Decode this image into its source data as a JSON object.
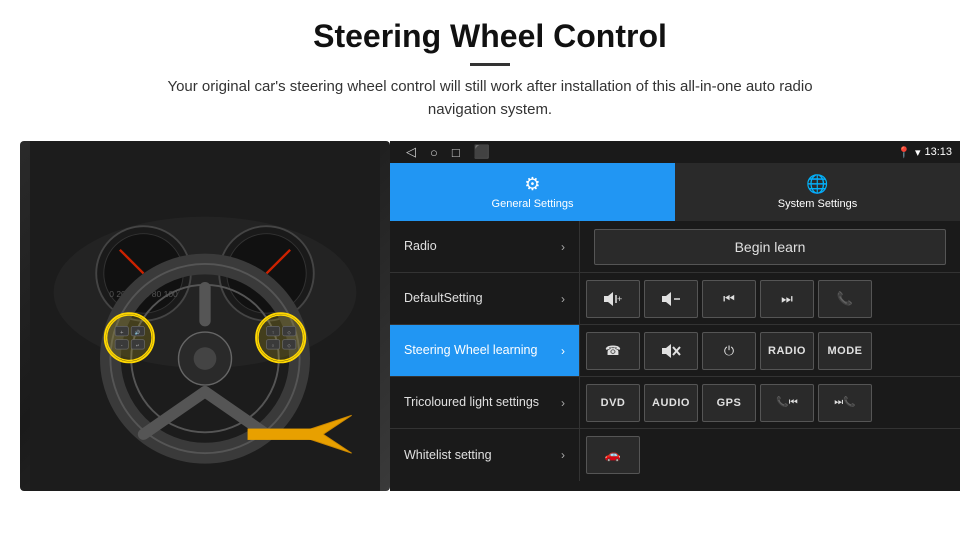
{
  "header": {
    "title": "Steering Wheel Control",
    "divider": true,
    "description": "Your original car's steering wheel control will still work after installation of this all-in-one auto radio navigation system."
  },
  "status_bar": {
    "nav": [
      "◁",
      "○",
      "□",
      "⬛"
    ],
    "time": "13:13",
    "icons": [
      "📍",
      "▾"
    ]
  },
  "tabs": [
    {
      "id": "general",
      "label": "General Settings",
      "icon": "⚙",
      "active": true
    },
    {
      "id": "system",
      "label": "System Settings",
      "icon": "🌐",
      "active": false
    }
  ],
  "menu_rows": [
    {
      "id": "radio",
      "label": "Radio",
      "active": false,
      "content_type": "begin_learn",
      "begin_learn_label": "Begin learn"
    },
    {
      "id": "default",
      "label": "DefaultSetting",
      "active": false,
      "content_type": "buttons_row1",
      "buttons": [
        {
          "icon": "🔊+",
          "type": "icon"
        },
        {
          "icon": "🔊-",
          "type": "icon"
        },
        {
          "icon": "⏮",
          "type": "icon"
        },
        {
          "icon": "⏭",
          "type": "icon"
        },
        {
          "icon": "📞",
          "type": "icon"
        }
      ]
    },
    {
      "id": "steering",
      "label": "Steering Wheel learning",
      "active": true,
      "content_type": "buttons_row2",
      "buttons": [
        {
          "icon": "☎",
          "type": "icon"
        },
        {
          "icon": "🔇",
          "type": "icon"
        },
        {
          "icon": "⏻",
          "type": "icon"
        },
        {
          "icon": "RADIO",
          "type": "text"
        },
        {
          "icon": "MODE",
          "type": "text"
        }
      ]
    },
    {
      "id": "tricolour",
      "label": "Tricoloured light settings",
      "active": false,
      "content_type": "buttons_row3",
      "buttons": [
        {
          "icon": "DVD",
          "type": "text"
        },
        {
          "icon": "AUDIO",
          "type": "text"
        },
        {
          "icon": "GPS",
          "type": "text"
        },
        {
          "icon": "📞⏮",
          "type": "icon"
        },
        {
          "icon": "⏭📞",
          "type": "icon"
        }
      ]
    },
    {
      "id": "whitelist",
      "label": "Whitelist setting",
      "active": false,
      "content_type": "buttons_row4",
      "buttons": [
        {
          "icon": "🚗",
          "type": "icon"
        }
      ]
    }
  ],
  "colors": {
    "active_blue": "#2196F3",
    "dark_bg": "#1a1a1a",
    "panel_bg": "#2a2a2a",
    "border": "#555",
    "text_light": "#e0e0e0"
  }
}
